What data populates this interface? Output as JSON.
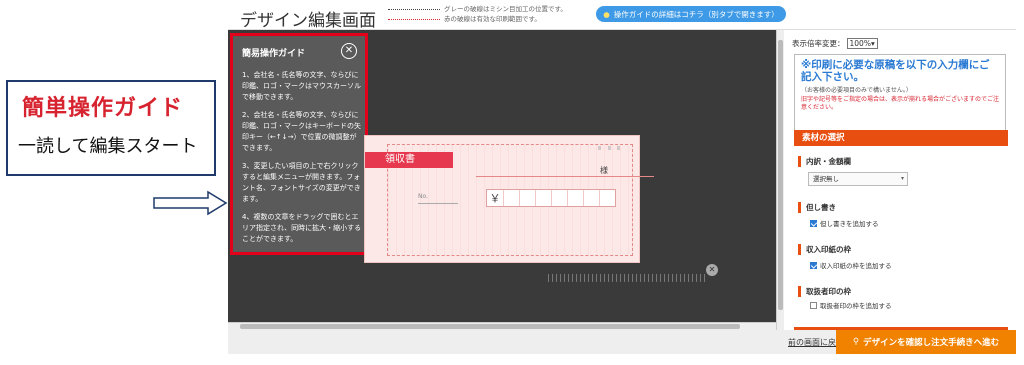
{
  "annotation": {
    "title": "簡単操作ガイド",
    "subtitle": "一読して編集スタート"
  },
  "header": {
    "page_title": "デザイン編集画面",
    "legend_gray": "グレーの破線はミシン目加工の位置です。",
    "legend_red": "赤の破線は有効な印刷範囲です。",
    "guide_button": "操作ガイドの詳細はコチラ（別タブで開きます）"
  },
  "guide": {
    "title": "簡易操作ガイド",
    "items": [
      "1、会社名・氏名等の文字、ならびに印鑑、ロゴ・マークはマウスカーソルで移動できます。",
      "2、会社名・氏名等の文字、ならびに印鑑、ロゴ・マークはキーボードの矢印キー（←↑↓→）で位置の微調整ができます。",
      "3、変更したい項目の上で右クリックすると編集メニューが開きます。フォント名、フォントサイズの変更ができます。",
      "4、複数の文章をドラッグで囲むとエリア指定され、同時に拡大・縮小することができます。"
    ]
  },
  "receipt": {
    "title": "領収書",
    "sama": "様",
    "no_label": "No.",
    "yen": "￥"
  },
  "right_panel": {
    "zoom_label": "表示倍率変更：",
    "zoom_value": "100%",
    "notice_heading": "※印刷に必要な原稿を以下の入力欄にご記入下さい。",
    "notice_sub": "（お客様の必要項目のみで構いません。）",
    "notice_warning": "旧字や記号等をご指定の場合は、表示が崩れる場合がございますのでご注意ください。",
    "section_title": "素材の選択",
    "content_label": "内訳・金額欄",
    "content_select": "選択無し",
    "tadashi_label": "但し書き",
    "tadashi_check": "但し書きを追加する",
    "stamp_label": "収入印紙の枠",
    "stamp_check": "収入印紙の枠を追加する",
    "handler_label": "取扱者印の枠",
    "handler_check": "取扱者印の枠を追加する"
  },
  "footer": {
    "back_link": "前の画面に戻る",
    "confirm_button": "デザインを確認し注文手続きへ進む"
  }
}
